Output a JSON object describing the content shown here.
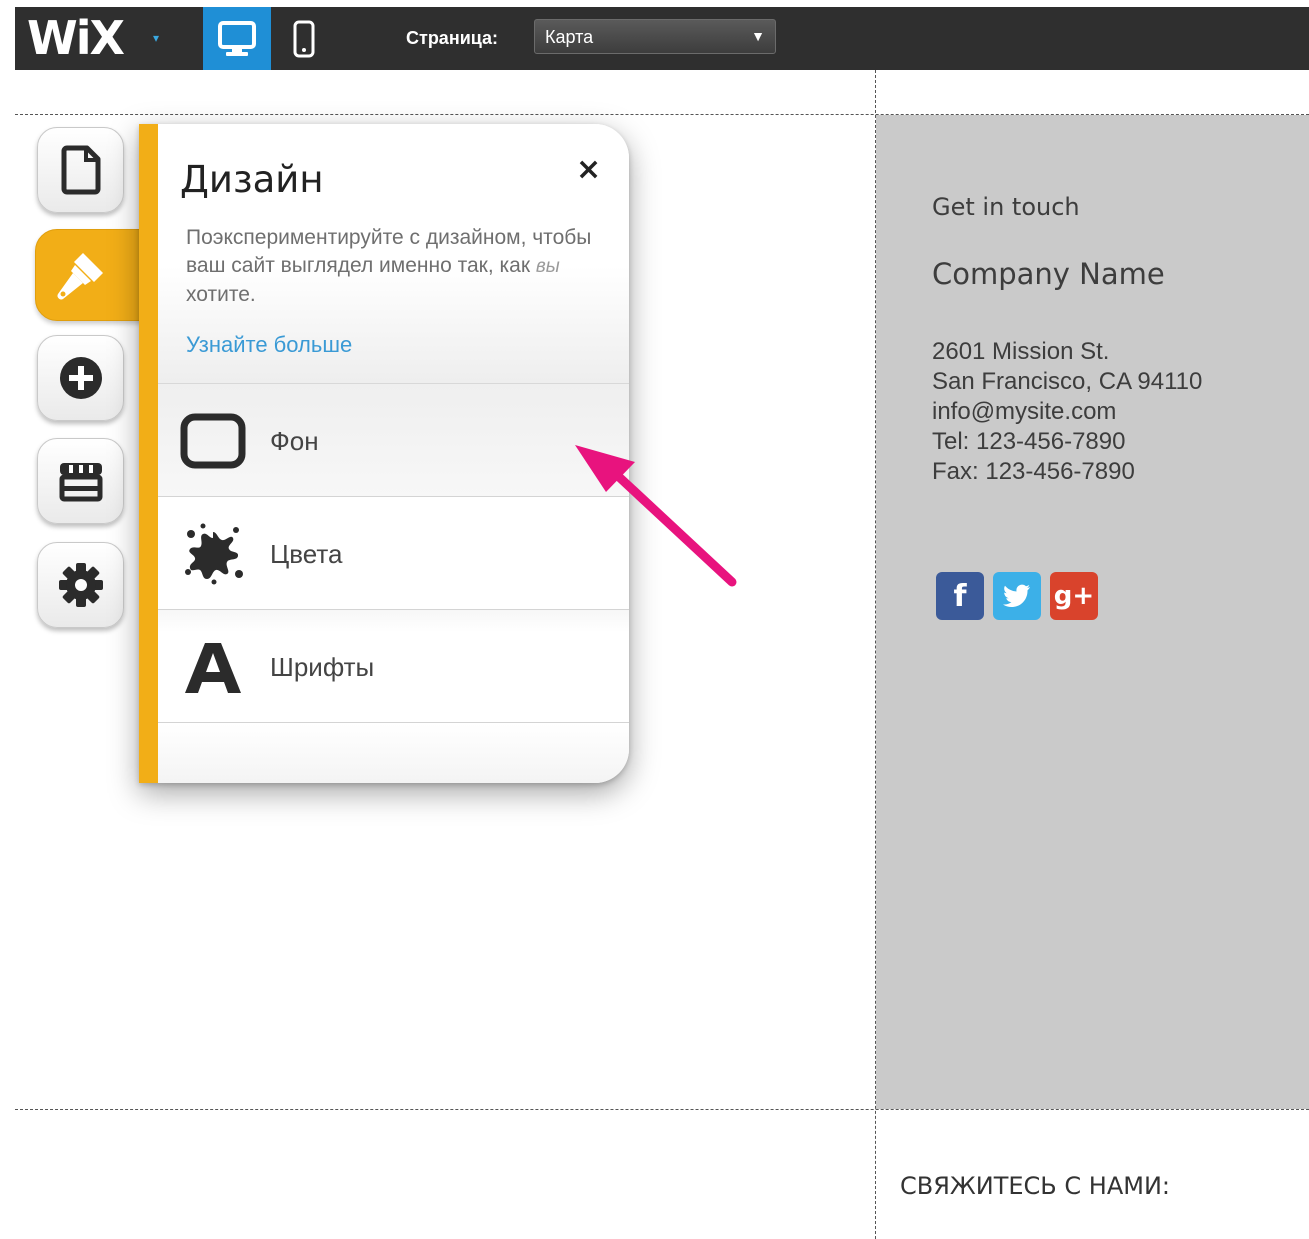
{
  "topbar": {
    "logo": "WiX",
    "logo_caret": "▾",
    "page_label": "Страница:",
    "page_select": {
      "value": "Карта",
      "arrow": "▼"
    }
  },
  "sidebar": {
    "items": [
      {
        "name": "pages",
        "icon": "page-icon",
        "active": false
      },
      {
        "name": "design",
        "icon": "brush-icon",
        "active": true
      },
      {
        "name": "add",
        "icon": "plus-circle-icon",
        "active": false
      },
      {
        "name": "store",
        "icon": "store-icon",
        "active": false
      },
      {
        "name": "settings",
        "icon": "gear-icon",
        "active": false
      }
    ]
  },
  "panel": {
    "title": "Дизайн",
    "close": "×",
    "description_part1": "Поэкспериментируйте с дизайном, чтобы ваш сайт выглядел именно так, как ",
    "description_italic": "вы",
    "description_part2": " хотите.",
    "link": "Узнайте больше",
    "menu": [
      {
        "label": "Фон",
        "icon": "background-frame-icon"
      },
      {
        "label": "Цвета",
        "icon": "paint-splash-icon"
      },
      {
        "label": "Шрифты",
        "icon": "font-a-icon"
      }
    ]
  },
  "contact": {
    "heading": "Get in touch",
    "company": "Company Name",
    "address_lines": [
      "2601 Mission St.",
      "San Francisco, CA 94110",
      "info@mysite.com",
      "Tel: 123-456-7890",
      "Fax: 123-456-7890"
    ],
    "social": [
      {
        "label": "f",
        "icon": "facebook-icon"
      },
      {
        "label": "t",
        "icon": "twitter-icon"
      },
      {
        "label": "g+",
        "icon": "google-plus-icon"
      }
    ]
  },
  "footer": {
    "heading": "СВЯЖИТЕСЬ С НАМИ:"
  },
  "colors": {
    "accent_orange": "#f2ae17",
    "toolbar_dark": "#2f2f2f",
    "active_device_blue": "#1f8fd6",
    "link_blue": "#3a9ad5",
    "annotation_arrow": "#e8137e",
    "contact_bg": "#cacaca"
  }
}
